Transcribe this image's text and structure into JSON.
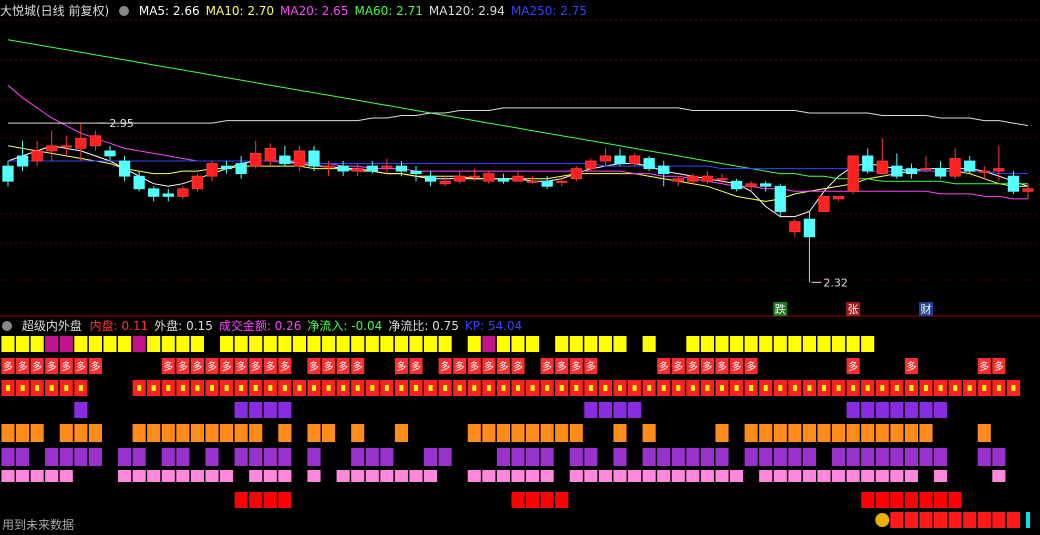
{
  "top_header": {
    "title": "大悦城(日线 前复权)",
    "indicators": [
      {
        "label": "MA5: 2.66",
        "color": "#ffffff"
      },
      {
        "label": "MA10: 2.70",
        "color": "#ffff55"
      },
      {
        "label": "MA20: 2.65",
        "color": "#ff44ff"
      },
      {
        "label": "MA60: 2.71",
        "color": "#44ff44"
      },
      {
        "label": "MA120: 2.94",
        "color": "#dddddd"
      },
      {
        "label": "MA250: 2.75",
        "color": "#3344ff"
      }
    ]
  },
  "bottom_header": {
    "title": "超级内外盘",
    "indicators": [
      {
        "label": "内盘: 0.11",
        "color": "#ff3333"
      },
      {
        "label": "外盘: 0.15",
        "color": "#dddddd"
      },
      {
        "label": "成交金额: 0.26",
        "color": "#ff44ff"
      },
      {
        "label": "净流入: -0.04",
        "color": "#44ff44"
      },
      {
        "label": "净流比: 0.75",
        "color": "#dddddd"
      },
      {
        "label": "KP: 54.04",
        "color": "#3344ff"
      }
    ]
  },
  "footer_text": "用到未来数据",
  "chart_data": {
    "type": "candlestick",
    "annotations": [
      {
        "text": "2.95",
        "index": 6
      },
      {
        "text": "2.32",
        "index": 55
      }
    ],
    "signals": [
      {
        "text": "跌",
        "index": 53,
        "bg": "#1f7a1f"
      },
      {
        "text": "张",
        "index": 58,
        "bg": "#a01818"
      },
      {
        "text": "财",
        "index": 63,
        "bg": "#1f3f8f"
      }
    ],
    "candles": [
      [
        2.78,
        2.72,
        2.8,
        2.7
      ],
      [
        2.82,
        2.78,
        2.88,
        2.76
      ],
      [
        2.8,
        2.84,
        2.88,
        2.78
      ],
      [
        2.84,
        2.86,
        2.92,
        2.8
      ],
      [
        2.86,
        2.86,
        2.9,
        2.82
      ],
      [
        2.85,
        2.89,
        2.95,
        2.8
      ],
      [
        2.86,
        2.9,
        2.92,
        2.84
      ],
      [
        2.84,
        2.82,
        2.86,
        2.8
      ],
      [
        2.8,
        2.74,
        2.82,
        2.72
      ],
      [
        2.74,
        2.69,
        2.76,
        2.68
      ],
      [
        2.69,
        2.66,
        2.7,
        2.64
      ],
      [
        2.67,
        2.66,
        2.69,
        2.64
      ],
      [
        2.66,
        2.69,
        2.7,
        2.65
      ],
      [
        2.69,
        2.74,
        2.75,
        2.68
      ],
      [
        2.74,
        2.79,
        2.8,
        2.72
      ],
      [
        2.78,
        2.77,
        2.8,
        2.75
      ],
      [
        2.79,
        2.75,
        2.82,
        2.73
      ],
      [
        2.78,
        2.83,
        2.88,
        2.77
      ],
      [
        2.8,
        2.85,
        2.87,
        2.78
      ],
      [
        2.82,
        2.79,
        2.86,
        2.78
      ],
      [
        2.78,
        2.84,
        2.86,
        2.76
      ],
      [
        2.84,
        2.78,
        2.86,
        2.76
      ],
      [
        2.78,
        2.78,
        2.8,
        2.74
      ],
      [
        2.78,
        2.76,
        2.8,
        2.74
      ],
      [
        2.76,
        2.77,
        2.79,
        2.74
      ],
      [
        2.78,
        2.76,
        2.8,
        2.75
      ],
      [
        2.78,
        2.78,
        2.81,
        2.75
      ],
      [
        2.78,
        2.76,
        2.8,
        2.74
      ],
      [
        2.76,
        2.75,
        2.78,
        2.72
      ],
      [
        2.74,
        2.72,
        2.76,
        2.7
      ],
      [
        2.71,
        2.72,
        2.74,
        2.7
      ],
      [
        2.72,
        2.74,
        2.76,
        2.71
      ],
      [
        2.74,
        2.74,
        2.77,
        2.72
      ],
      [
        2.72,
        2.75,
        2.76,
        2.71
      ],
      [
        2.73,
        2.72,
        2.75,
        2.71
      ],
      [
        2.72,
        2.74,
        2.76,
        2.72
      ],
      [
        2.72,
        2.72,
        2.74,
        2.71
      ],
      [
        2.72,
        2.7,
        2.74,
        2.69
      ],
      [
        2.72,
        2.72,
        2.74,
        2.7
      ],
      [
        2.73,
        2.77,
        2.78,
        2.72
      ],
      [
        2.77,
        2.8,
        2.81,
        2.76
      ],
      [
        2.8,
        2.82,
        2.85,
        2.78
      ],
      [
        2.82,
        2.79,
        2.85,
        2.78
      ],
      [
        2.79,
        2.82,
        2.83,
        2.78
      ],
      [
        2.81,
        2.77,
        2.82,
        2.76
      ],
      [
        2.78,
        2.75,
        2.8,
        2.7
      ],
      [
        2.72,
        2.73,
        2.74,
        2.7
      ],
      [
        2.72,
        2.74,
        2.75,
        2.71
      ],
      [
        2.72,
        2.74,
        2.76,
        2.71
      ],
      [
        2.73,
        2.73,
        2.75,
        2.71
      ],
      [
        2.72,
        2.69,
        2.73,
        2.68
      ],
      [
        2.7,
        2.71,
        2.72,
        2.68
      ],
      [
        2.71,
        2.7,
        2.72,
        2.68
      ],
      [
        2.7,
        2.6,
        2.71,
        2.58
      ],
      [
        2.52,
        2.56,
        2.57,
        2.5
      ],
      [
        2.57,
        2.5,
        2.6,
        2.32
      ],
      [
        2.6,
        2.66,
        2.66,
        2.6
      ],
      [
        2.65,
        2.66,
        2.66,
        2.64
      ],
      [
        2.68,
        2.82,
        2.82,
        2.67
      ],
      [
        2.82,
        2.76,
        2.85,
        2.75
      ],
      [
        2.75,
        2.8,
        2.89,
        2.75
      ],
      [
        2.78,
        2.74,
        2.83,
        2.73
      ],
      [
        2.77,
        2.75,
        2.79,
        2.73
      ],
      [
        2.77,
        2.77,
        2.82,
        2.76
      ],
      [
        2.77,
        2.74,
        2.8,
        2.73
      ],
      [
        2.74,
        2.81,
        2.85,
        2.73
      ],
      [
        2.8,
        2.76,
        2.82,
        2.75
      ],
      [
        2.76,
        2.76,
        2.78,
        2.73
      ],
      [
        2.76,
        2.77,
        2.86,
        2.72
      ],
      [
        2.74,
        2.68,
        2.76,
        2.67
      ],
      [
        2.68,
        2.69,
        2.71,
        2.65
      ]
    ],
    "ma_lines": [
      {
        "name": "MA5",
        "color": "#ffffff",
        "values": [
          2.8,
          2.82,
          2.84,
          2.86,
          2.85,
          2.84,
          2.82,
          2.8,
          2.77,
          2.74,
          2.71,
          2.7,
          2.71,
          2.73,
          2.75,
          2.77,
          2.79,
          2.8,
          2.8,
          2.8,
          2.79,
          2.78,
          2.78,
          2.77,
          2.77,
          2.76,
          2.75,
          2.75,
          2.74,
          2.73,
          2.73,
          2.73,
          2.73,
          2.73,
          2.73,
          2.73,
          2.72,
          2.72,
          2.73,
          2.75,
          2.77,
          2.78,
          2.79,
          2.79,
          2.78,
          2.76,
          2.75,
          2.74,
          2.73,
          2.72,
          2.71,
          2.68,
          2.62,
          2.58,
          2.58,
          2.6,
          2.68,
          2.74,
          2.78,
          2.79,
          2.78,
          2.77,
          2.76,
          2.77,
          2.77,
          2.77,
          2.77,
          2.76,
          2.74,
          2.72,
          2.7
        ]
      },
      {
        "name": "MA10",
        "color": "#ffff55",
        "values": [
          2.86,
          2.85,
          2.84,
          2.83,
          2.82,
          2.81,
          2.8,
          2.79,
          2.77,
          2.76,
          2.75,
          2.75,
          2.76,
          2.76,
          2.77,
          2.77,
          2.78,
          2.78,
          2.78,
          2.78,
          2.78,
          2.77,
          2.77,
          2.77,
          2.76,
          2.76,
          2.75,
          2.75,
          2.74,
          2.74,
          2.74,
          2.74,
          2.73,
          2.73,
          2.73,
          2.73,
          2.73,
          2.73,
          2.74,
          2.75,
          2.75,
          2.75,
          2.75,
          2.75,
          2.74,
          2.73,
          2.72,
          2.71,
          2.7,
          2.68,
          2.66,
          2.65,
          2.64,
          2.65,
          2.67,
          2.68,
          2.69,
          2.7,
          2.71,
          2.73,
          2.74,
          2.75,
          2.76,
          2.76,
          2.76,
          2.76,
          2.75,
          2.73,
          2.71,
          2.7,
          2.7
        ]
      },
      {
        "name": "MA20",
        "color": "#ff44ff",
        "values": [
          3.1,
          3.05,
          3.01,
          2.97,
          2.94,
          2.91,
          2.89,
          2.87,
          2.85,
          2.84,
          2.83,
          2.82,
          2.81,
          2.8,
          2.8,
          2.8,
          2.8,
          2.8,
          2.8,
          2.8,
          2.8,
          2.79,
          2.79,
          2.78,
          2.78,
          2.77,
          2.77,
          2.77,
          2.76,
          2.76,
          2.76,
          2.76,
          2.76,
          2.76,
          2.76,
          2.76,
          2.76,
          2.76,
          2.76,
          2.76,
          2.76,
          2.76,
          2.76,
          2.75,
          2.75,
          2.74,
          2.74,
          2.73,
          2.72,
          2.71,
          2.7,
          2.7,
          2.69,
          2.69,
          2.68,
          2.68,
          2.68,
          2.68,
          2.68,
          2.68,
          2.68,
          2.68,
          2.68,
          2.68,
          2.67,
          2.67,
          2.67,
          2.66,
          2.66,
          2.65,
          2.65
        ]
      },
      {
        "name": "MA60",
        "color": "#44ff44",
        "values": [
          3.28,
          3.27,
          3.26,
          3.25,
          3.24,
          3.23,
          3.22,
          3.21,
          3.2,
          3.19,
          3.18,
          3.17,
          3.16,
          3.15,
          3.14,
          3.13,
          3.12,
          3.11,
          3.1,
          3.09,
          3.08,
          3.07,
          3.06,
          3.05,
          3.04,
          3.03,
          3.02,
          3.01,
          3.0,
          2.99,
          2.98,
          2.97,
          2.96,
          2.95,
          2.94,
          2.93,
          2.92,
          2.91,
          2.9,
          2.89,
          2.88,
          2.87,
          2.86,
          2.85,
          2.84,
          2.83,
          2.82,
          2.81,
          2.8,
          2.79,
          2.78,
          2.77,
          2.76,
          2.75,
          2.75,
          2.74,
          2.74,
          2.73,
          2.73,
          2.73,
          2.72,
          2.72,
          2.72,
          2.72,
          2.72,
          2.71,
          2.71,
          2.71,
          2.71,
          2.71,
          2.71
        ]
      },
      {
        "name": "MA120",
        "color": "#dddddd",
        "values": [
          2.95,
          2.95,
          2.95,
          2.95,
          2.95,
          2.95,
          2.95,
          2.95,
          2.95,
          2.95,
          2.95,
          2.95,
          2.95,
          2.95,
          2.95,
          2.96,
          2.96,
          2.96,
          2.96,
          2.96,
          2.96,
          2.96,
          2.96,
          2.96,
          2.96,
          2.97,
          2.97,
          2.98,
          2.98,
          2.99,
          2.99,
          3.0,
          3.0,
          3.0,
          3.01,
          3.01,
          3.01,
          3.01,
          3.01,
          3.01,
          3.01,
          3.01,
          3.01,
          3.01,
          3.01,
          3.01,
          3.01,
          3.0,
          3.0,
          3.0,
          3.0,
          3.0,
          3.0,
          3.0,
          3.0,
          2.99,
          2.99,
          2.99,
          2.99,
          2.99,
          2.98,
          2.98,
          2.98,
          2.98,
          2.97,
          2.97,
          2.97,
          2.96,
          2.96,
          2.95,
          2.94
        ]
      },
      {
        "name": "MA250",
        "color": "#3344ff",
        "values": [
          2.8,
          2.8,
          2.8,
          2.8,
          2.8,
          2.8,
          2.8,
          2.8,
          2.8,
          2.8,
          2.8,
          2.8,
          2.8,
          2.8,
          2.8,
          2.8,
          2.8,
          2.8,
          2.8,
          2.79,
          2.79,
          2.79,
          2.79,
          2.79,
          2.79,
          2.79,
          2.79,
          2.79,
          2.79,
          2.79,
          2.79,
          2.79,
          2.79,
          2.79,
          2.79,
          2.79,
          2.79,
          2.79,
          2.79,
          2.79,
          2.79,
          2.78,
          2.78,
          2.78,
          2.78,
          2.78,
          2.78,
          2.78,
          2.78,
          2.77,
          2.77,
          2.77,
          2.77,
          2.77,
          2.77,
          2.77,
          2.77,
          2.77,
          2.77,
          2.76,
          2.76,
          2.76,
          2.76,
          2.76,
          2.76,
          2.76,
          2.76,
          2.76,
          2.75,
          2.75,
          2.75
        ]
      }
    ],
    "signal_rows": [
      {
        "color": "#ffff00",
        "kind": "mixed",
        "text": "",
        "values": "YYYPPYYYYPYYYY.YYYYYYYYYYYYYYYY.YPYYY.YYYYY.Y..YYYYYYYYYYYYY"
      },
      {
        "color": "#ff2d2d",
        "kind": "text",
        "text": "多",
        "values": "1111111000011111111101111001101111110111100001111111000000100010000110"
      },
      {
        "color": "#ff2020",
        "kind": "box",
        "text": "",
        "values": "1111110001111111111111111111111111111111111111111111111111111111111111"
      },
      {
        "color": "#8a2be2",
        "kind": "box",
        "text": "",
        "values": "0000010000000000111100000000000000000000111100000000000000111111100000"
      },
      {
        "color": "#ff8c1a",
        "kind": "box",
        "text": "",
        "values": "1110111001111111110101101001000011111111001010000101111111111111000100"
      },
      {
        "color": "#9932cc",
        "kind": "box",
        "text": "",
        "values": "1101111011011010111101001110011000111101101011111101111101111111100110"
      },
      {
        "color": "#ff88dd",
        "kind": "box",
        "text": "",
        "values": "1111100011111111011101011111110011111101111111111110111111111110100010"
      },
      {
        "color": "#ff0000",
        "kind": "box",
        "text": "",
        "values": "0000000000000000111100000000000000011110000000000000000000011111110000"
      }
    ]
  }
}
